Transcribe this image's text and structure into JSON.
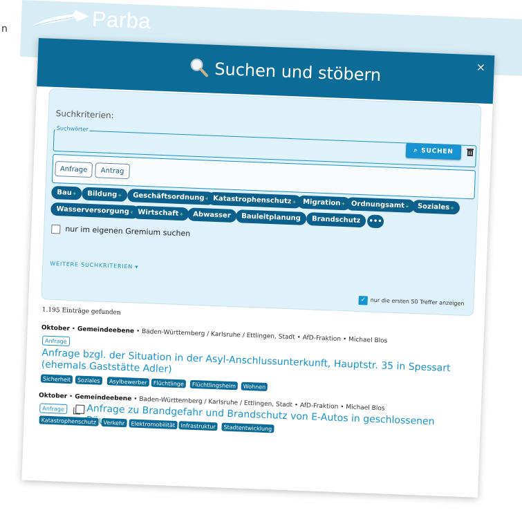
{
  "side_letter": "n",
  "app": {
    "brand": "Parba"
  },
  "dialog": {
    "title": "Suchen und stöbern",
    "close": "×",
    "criteria_label": "Suchkriterien:",
    "search_legend": "Suchwörter",
    "search_value": "",
    "search_button": "SUCHEN",
    "types": [
      "Anfrage",
      "Antrag"
    ],
    "topics": [
      {
        "label": "Bau"
      },
      {
        "label": "Bildung"
      },
      {
        "label": "Geschäftsordnung"
      },
      {
        "label": "Katastrophenschutz"
      },
      {
        "label": "Migration"
      },
      {
        "label": "Ordnungsamt"
      },
      {
        "label": "Soziales"
      },
      {
        "label": "Wasserversorgung"
      },
      {
        "label": "Wirtschaft"
      },
      {
        "label": "Abwasser"
      },
      {
        "label": "Bauleitplanung"
      },
      {
        "label": "Brandschutz"
      },
      {
        "label": "•••"
      }
    ],
    "own_gremium": "nur im eigenen Gremium suchen",
    "more_criteria": "WEITERE SUCHKRITERIEN ▾",
    "first50": "nur die ersten 50 Treffer anzeigen"
  },
  "results": {
    "count": "1.195 Einträge gefunden",
    "items": [
      {
        "meta_month": "Oktober",
        "meta_level": "Gemeindeebene",
        "meta_rest": "• Baden-Württemberg / Karlsruhe / Ettlingen, Stadt • AfD-Fraktion • Michael Blos",
        "type": "Anfrage",
        "title": "Anfrage bzgl. der Situation in der Asyl-Anschlussunterkunft, Hauptstr. 35 in Spessart (ehemals Gaststätte Adler)",
        "tags": [
          "Sicherheit",
          "Soziales",
          "Asylbewerber",
          "Flüchtlinge",
          "Flüchtlingsheim",
          "Wohnen"
        ]
      },
      {
        "meta_month": "Oktober",
        "meta_level": "Gemeindeebene",
        "meta_rest": "• Baden-Württemberg / Karlsruhe / Ettlingen, Stadt • AfD-Fraktion • Michael Blos",
        "type": "Anfrage",
        "title": "Anfrage zu Brandgefahr und Brandschutz von E-Autos in geschlossenen Räumen",
        "tags": [
          "Katastrophenschutz",
          "Verkehr",
          "Elektromobilität",
          "Infrastruktur",
          "Stadtentwicklung"
        ]
      }
    ]
  },
  "colors": {
    "header": "#0c6b97",
    "accent": "#1793d1",
    "panel": "#dff1fa",
    "tag": "#0c5f8a"
  }
}
